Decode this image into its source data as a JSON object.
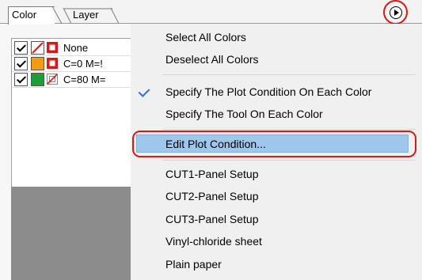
{
  "tabs": [
    {
      "label": "Color",
      "active": true
    },
    {
      "label": "Layer",
      "active": false
    }
  ],
  "panel_menu_button": {
    "icon": "circle-arrow-right-icon"
  },
  "color_list": [
    {
      "checked": true,
      "swatch_color": "#ffffff",
      "swatch_slash": true,
      "tool_color": "#d7191c",
      "tool_slash": false,
      "label": "None"
    },
    {
      "checked": true,
      "swatch_color": "#f39c12",
      "swatch_slash": false,
      "tool_color": "#d7191c",
      "tool_slash": false,
      "label": "C=0 M=!"
    },
    {
      "checked": true,
      "swatch_color": "#1a9e3a",
      "swatch_slash": false,
      "tool_color": "#ffffff",
      "tool_slash": true,
      "label": "C=80 M="
    }
  ],
  "menu": {
    "items": [
      {
        "label": "Select All Colors",
        "checked": false,
        "selected": false
      },
      {
        "label": "Deselect All Colors",
        "checked": false,
        "selected": false
      },
      {
        "label": "Specify The Plot Condition On Each Color",
        "checked": true,
        "selected": false
      },
      {
        "label": "Specify The Tool On Each Color",
        "checked": false,
        "selected": false
      },
      {
        "label": "Edit Plot Condition...",
        "checked": false,
        "selected": true
      },
      {
        "label": "CUT1-Panel Setup",
        "checked": false,
        "selected": false
      },
      {
        "label": "CUT2-Panel Setup",
        "checked": false,
        "selected": false
      },
      {
        "label": "CUT3-Panel Setup",
        "checked": false,
        "selected": false
      },
      {
        "label": "Vinyl-chloride sheet",
        "checked": false,
        "selected": false
      },
      {
        "label": "Plain paper",
        "checked": false,
        "selected": false
      }
    ]
  },
  "colors": {
    "highlight_ring": "#d7191c",
    "menu_selected": "#9fc7ee",
    "checkmark": "#2b6fd6"
  }
}
